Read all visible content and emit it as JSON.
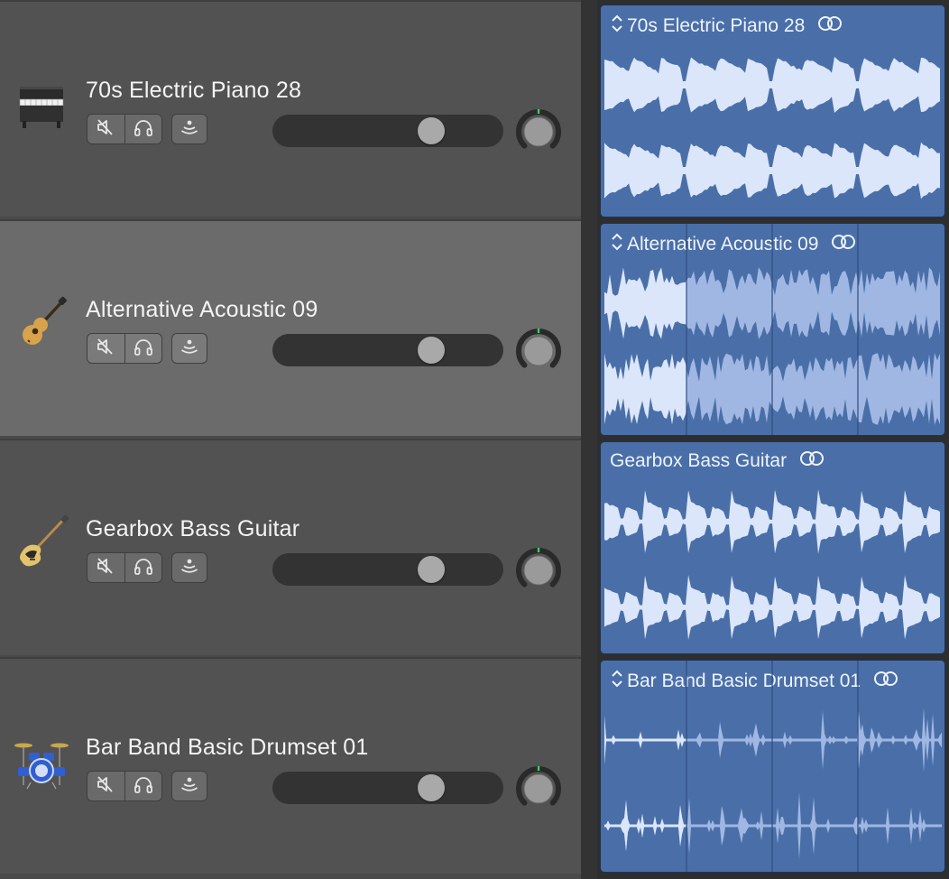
{
  "tracks": [
    {
      "name": "70s Electric Piano 28",
      "instrument_icon": "electric-piano-icon",
      "volume": 0.72,
      "pan": 0,
      "selected": false,
      "region": {
        "name": "70s Electric Piano 28",
        "has_collapse_chevron": true,
        "wave_style": "piano"
      }
    },
    {
      "name": "Alternative Acoustic 09",
      "instrument_icon": "acoustic-guitar-icon",
      "volume": 0.72,
      "pan": 0,
      "selected": true,
      "region": {
        "name": "Alternative Acoustic 09",
        "has_collapse_chevron": true,
        "wave_style": "acoustic"
      }
    },
    {
      "name": "Gearbox Bass Guitar",
      "instrument_icon": "bass-guitar-icon",
      "volume": 0.72,
      "pan": 0,
      "selected": false,
      "region": {
        "name": "Gearbox Bass Guitar",
        "has_collapse_chevron": false,
        "wave_style": "bass"
      }
    },
    {
      "name": "Bar Band Basic Drumset 01",
      "instrument_icon": "drumset-icon",
      "volume": 0.72,
      "pan": 0,
      "selected": false,
      "region": {
        "name": "Bar Band Basic Drumset 01",
        "has_collapse_chevron": true,
        "wave_style": "drums"
      }
    }
  ],
  "controls": {
    "mute_icon": "mute-speaker-icon",
    "solo_icon": "headphones-icon",
    "input_monitor_icon": "input-monitor-icon",
    "pan_knob_icon": "pan-knob-icon",
    "loop_icon": "loop-rings-icon"
  },
  "colors": {
    "header_bg": "#525252",
    "header_selected_bg": "#6b6b6b",
    "region_bg": "#4a6fa8",
    "waveform": "#dbe6fb",
    "waveform_dim": "#9fb7e2",
    "knob_indicator": "#39d06a"
  }
}
